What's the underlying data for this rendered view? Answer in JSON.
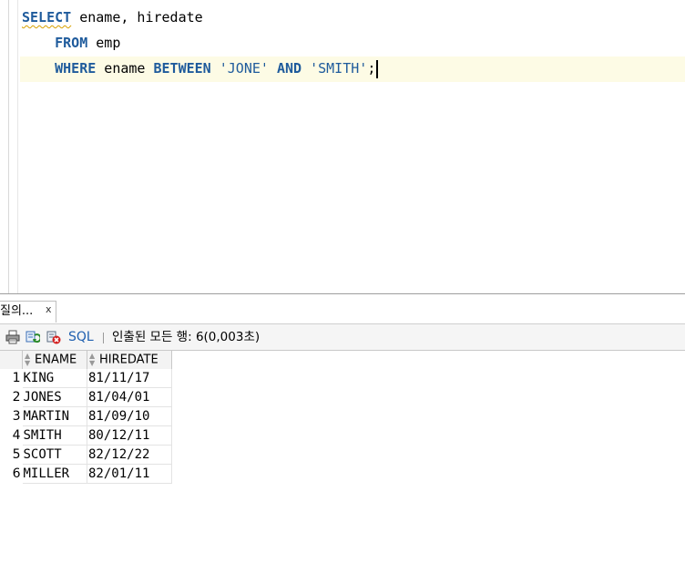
{
  "editor": {
    "lines": [
      {
        "indent": "",
        "tokens": [
          {
            "t": "SELECT",
            "kind": "kw-squiggle"
          },
          {
            "t": " ename, hiredate",
            "kind": "plain"
          }
        ]
      },
      {
        "indent": "    ",
        "tokens": [
          {
            "t": "FROM",
            "kind": "kw"
          },
          {
            "t": " emp",
            "kind": "plain"
          }
        ]
      },
      {
        "indent": "    ",
        "tokens": [
          {
            "t": "WHERE",
            "kind": "kw"
          },
          {
            "t": " ename ",
            "kind": "plain"
          },
          {
            "t": "BETWEEN",
            "kind": "kw"
          },
          {
            "t": " ",
            "kind": "plain"
          },
          {
            "t": "'JONE'",
            "kind": "str"
          },
          {
            "t": " ",
            "kind": "plain"
          },
          {
            "t": "AND",
            "kind": "kw"
          },
          {
            "t": " ",
            "kind": "plain"
          },
          {
            "t": "'SMITH'",
            "kind": "str"
          },
          {
            "t": ";",
            "kind": "plain"
          }
        ],
        "current": true
      }
    ]
  },
  "results": {
    "tab_label": "질의...",
    "tab_close": "x",
    "toolbar": {
      "icons": [
        "print-icon",
        "refresh-icon",
        "cancel-icon"
      ],
      "sql_label": "SQL",
      "separator": "|",
      "status": "인출된 모든 행: 6(0,003초)"
    },
    "columns": [
      "ENAME",
      "HIREDATE"
    ],
    "rows": [
      [
        "1",
        "KING",
        "81/11/17"
      ],
      [
        "2",
        "JONES",
        "81/04/01"
      ],
      [
        "3",
        "MARTIN",
        "81/09/10"
      ],
      [
        "4",
        "SMITH",
        "80/12/11"
      ],
      [
        "5",
        "SCOTT",
        "82/12/22"
      ],
      [
        "6",
        "MILLER",
        "82/01/11"
      ]
    ]
  }
}
